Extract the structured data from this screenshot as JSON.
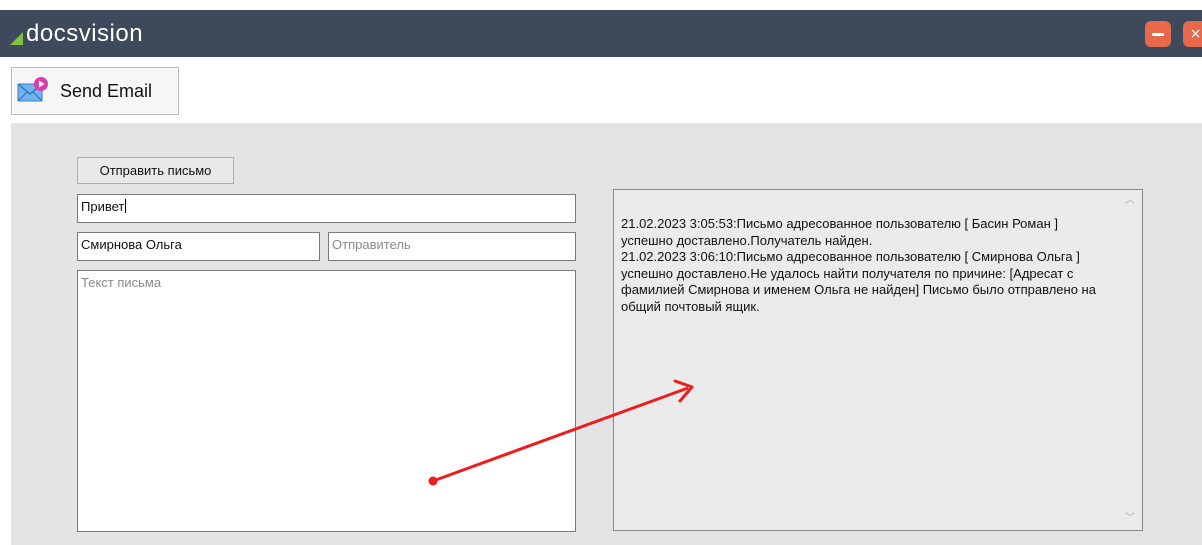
{
  "app": {
    "logo_text": "docsvision",
    "logo_color": "#7ec242",
    "titlebar_color": "#3e4a5b",
    "window_button_color": "#e8684a"
  },
  "toolbar": {
    "send_email_label": "Send Email",
    "send_email_icon": "email-send-icon"
  },
  "form": {
    "send_button_label": "Отправить письмо",
    "subject_value": "Привет",
    "recipient_value": "Смирнова Ольга",
    "sender_placeholder": "Отправитель",
    "body_placeholder": "Текст письма"
  },
  "log": {
    "entries": [
      "21.02.2023 3:05:53:Письмо адресованное пользователю [ Басин Роман ] успешно доставлено.Получатель найден.",
      "21.02.2023 3:06:10:Письмо адресованное пользователю [ Смирнова Ольга ] успешно доставлено.Не удалось найти получателя по причине:  [Адресат с фамилией Смирнова и именем Ольга не найден] Письмо было отправлено на общий почтовый ящик."
    ]
  },
  "annotation": {
    "arrow_color": "#ee1c1c"
  }
}
